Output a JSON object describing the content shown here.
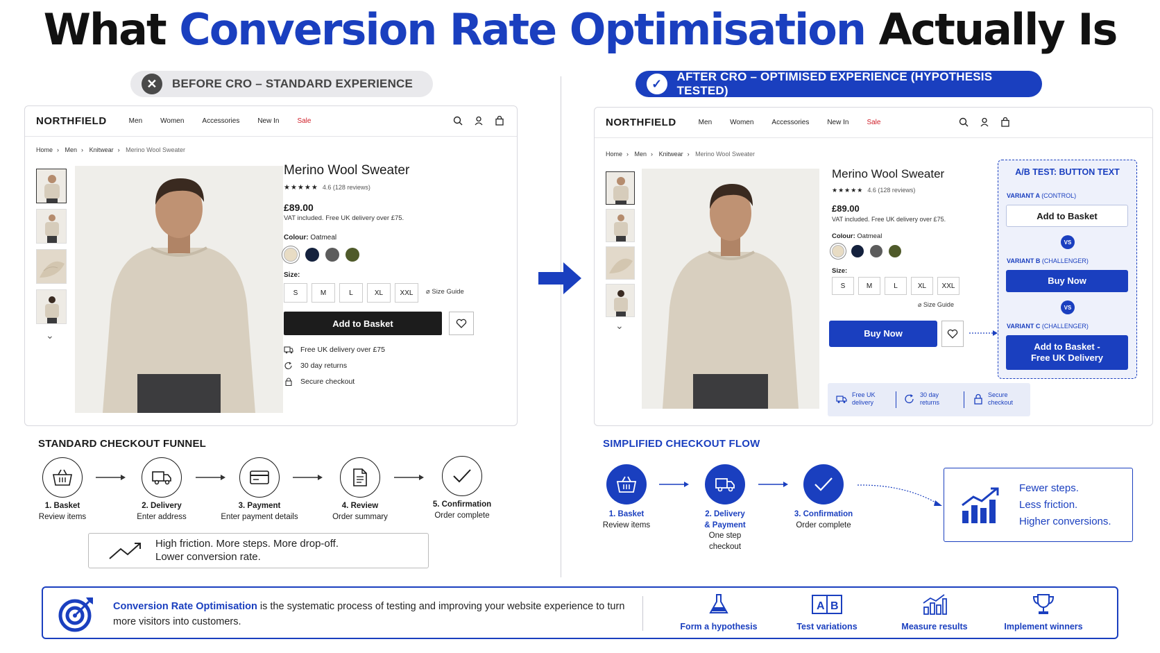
{
  "title": {
    "part1": "What ",
    "highlight": "Conversion Rate Optimisation",
    "part2": " Actually Is"
  },
  "before_pill": {
    "icon": "x-circle-icon",
    "label": "BEFORE CRO – STANDARD EXPERIENCE"
  },
  "after_pill": {
    "icon": "check-circle-icon",
    "label": "AFTER CRO – OPTIMISED EXPERIENCE (HYPOTHESIS TESTED)"
  },
  "store": {
    "logo": "NORTHFIELD",
    "nav": [
      "Men",
      "Women",
      "Accessories",
      "New In",
      "Sale"
    ],
    "breadcrumb": [
      "Home",
      "Men",
      "Knitwear",
      "Merino Wool Sweater"
    ],
    "breadcrumb_sep": "›",
    "product_title": "Merino Wool Sweater",
    "stars": "★★★★★",
    "rating": "4.6 (128 reviews)",
    "price": "£89.00",
    "vat": "VAT included. Free UK delivery over £75.",
    "colour_label": "Colour:",
    "colour_value": "Oatmeal",
    "swatches": [
      "#e8dcc4",
      "#14213d",
      "#5c5c5c",
      "#4f5a2a"
    ],
    "size_label": "Size:",
    "sizes": [
      "S",
      "M",
      "L",
      "XL",
      "XXL"
    ],
    "size_guide": "Size Guide",
    "chevron": "⌄"
  },
  "before": {
    "cta": "Add to Basket",
    "perks": [
      "Free UK delivery over £75",
      "30 day returns",
      "Secure checkout"
    ],
    "funnel_title": "STANDARD CHECKOUT FUNNEL",
    "steps": [
      {
        "title": "1. Basket",
        "sub": "Review items",
        "icon": "basket-icon"
      },
      {
        "title": "2. Delivery",
        "sub": "Enter address",
        "icon": "truck-icon"
      },
      {
        "title": "3. Payment",
        "sub": "Enter payment details",
        "icon": "card-icon"
      },
      {
        "title": "4. Review",
        "sub": "Order summary",
        "icon": "document-icon"
      },
      {
        "title": "5. Confirmation",
        "sub": "Order complete",
        "icon": "check-icon"
      }
    ],
    "friction_line1": "High friction. More steps. More drop-off.",
    "friction_line2": "Lower conversion rate."
  },
  "after": {
    "cta": "Buy Now",
    "trust": [
      {
        "line1": "Free UK",
        "line2": "delivery"
      },
      {
        "line1": "30 day",
        "line2": "returns"
      },
      {
        "line1": "Secure",
        "line2": "checkout"
      }
    ],
    "ab_test": {
      "title": "A/B TEST: BUTTON TEXT",
      "variants": [
        {
          "name": "VARIANT A",
          "kind": "(CONTROL)",
          "label": "Add to Basket"
        },
        {
          "name": "VARIANT B",
          "kind": "(CHALLENGER)",
          "label": "Buy Now"
        },
        {
          "name": "VARIANT C",
          "kind": "(CHALLENGER)",
          "label": "Add to Basket -\nFree UK Delivery"
        }
      ],
      "vs": "VS"
    },
    "funnel_title": "SIMPLIFIED CHECKOUT FLOW",
    "steps": [
      {
        "title": "1. Basket",
        "sub": "Review items",
        "icon": "basket-icon"
      },
      {
        "title": "2. Delivery\n& Payment",
        "sub": "One step\ncheckout",
        "icon": "truck-icon"
      },
      {
        "title": "3. Confirmation",
        "sub": "Order complete",
        "icon": "check-icon"
      }
    ],
    "benefit": [
      "Fewer steps.",
      "Less friction.",
      "Higher conversions."
    ]
  },
  "definition": {
    "keyword": "Conversion Rate Optimisation",
    "rest": " is the systematic process of testing and improving your website experience to turn more visitors into customers."
  },
  "process": [
    {
      "label": "Form a hypothesis",
      "icon": "flask-icon"
    },
    {
      "label": "Test variations",
      "icon": "ab-test-icon"
    },
    {
      "label": "Measure results",
      "icon": "bar-chart-icon"
    },
    {
      "label": "Implement winners",
      "icon": "trophy-icon"
    }
  ],
  "colors": {
    "accent": "#1a3fbf",
    "dark": "#1c1c1c",
    "sale": "#d0202a"
  }
}
